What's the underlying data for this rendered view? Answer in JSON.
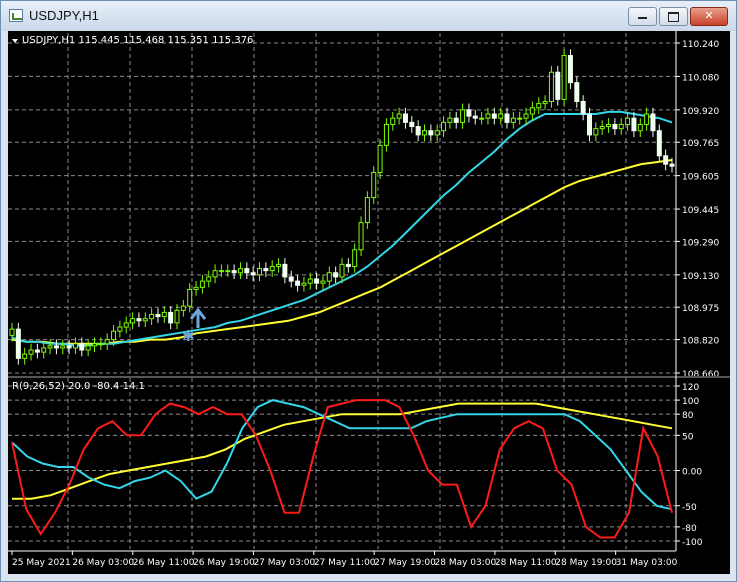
{
  "window": {
    "title": "USDJPY,H1",
    "min_label": "–",
    "max_label": "▢",
    "close_label": "✕"
  },
  "main_panel": {
    "info_label": "USDJPY,H1  115.445 115.468 115.351 115.376"
  },
  "indicator_panel": {
    "info_label": "R(9,26,52) 20.0 -80.4 14.1"
  },
  "colors": {
    "background": "#000000",
    "grid": "#8a8a8a",
    "bull_candle": "#7cfc00",
    "bear_candle": "#f0fff0",
    "ma_fast": "#33d6e8",
    "ma_slow": "#ffff33",
    "osc_red": "#ff1a1a",
    "osc_cyan": "#33d6e8",
    "osc_yellow": "#ffff33",
    "arrow": "#6fa8dc"
  },
  "chart_data": [
    {
      "type": "candlestick",
      "title": "USDJPY,H1",
      "y_axis_ticks": [
        "110.240",
        "110.080",
        "109.920",
        "109.765",
        "109.605",
        "109.445",
        "109.290",
        "109.130",
        "108.975",
        "108.820",
        "108.660"
      ],
      "ylim": [
        108.66,
        110.24
      ],
      "x_axis_ticks": [
        "25 May 2021",
        "26 May 03:00",
        "26 May 11:00",
        "26 May 19:00",
        "27 May 03:00",
        "27 May 11:00",
        "27 May 19:00",
        "28 May 03:00",
        "28 May 11:00",
        "28 May 19:00",
        "31 May 03:00"
      ],
      "grid": true,
      "close": [
        108.87,
        108.73,
        108.75,
        108.77,
        108.76,
        108.78,
        108.79,
        108.78,
        108.79,
        108.78,
        108.8,
        108.77,
        108.79,
        108.8,
        108.8,
        108.82,
        108.86,
        108.88,
        108.9,
        108.92,
        108.91,
        108.92,
        108.94,
        108.93,
        108.95,
        108.9,
        108.96,
        108.98,
        109.06,
        109.07,
        109.1,
        109.12,
        109.15,
        109.15,
        109.15,
        109.14,
        109.16,
        109.14,
        109.13,
        109.16,
        109.15,
        109.17,
        109.18,
        109.12,
        109.1,
        109.08,
        109.09,
        109.11,
        109.09,
        109.1,
        109.14,
        109.12,
        109.18,
        109.17,
        109.25,
        109.38,
        109.5,
        109.62,
        109.75,
        109.85,
        109.88,
        109.9,
        109.86,
        109.84,
        109.8,
        109.82,
        109.8,
        109.82,
        109.86,
        109.88,
        109.86,
        109.92,
        109.89,
        109.88,
        109.88,
        109.9,
        109.88,
        109.9,
        109.86,
        109.88,
        109.88,
        109.9,
        109.93,
        109.95,
        109.96,
        110.1,
        109.97,
        110.18,
        110.05,
        109.96,
        109.9,
        109.8,
        109.83,
        109.84,
        109.85,
        109.83,
        109.85,
        109.88,
        109.82,
        109.85,
        109.9,
        109.82,
        109.7,
        109.66,
        109.65
      ],
      "series": [
        {
          "name": "MA fast",
          "values": [
            108.83,
            108.81,
            108.81,
            108.8,
            108.8,
            108.79,
            108.79,
            108.8,
            108.8,
            108.81,
            108.82,
            108.83,
            108.84,
            108.85,
            108.86,
            108.87,
            108.88,
            108.9,
            108.91,
            108.93,
            108.95,
            108.97,
            108.99,
            109.01,
            109.04,
            109.07,
            109.1,
            109.13,
            109.17,
            109.22,
            109.27,
            109.33,
            109.39,
            109.45,
            109.51,
            109.56,
            109.62,
            109.67,
            109.72,
            109.78,
            109.83,
            109.87,
            109.9,
            109.9,
            109.9,
            109.9,
            109.9,
            109.91,
            109.91,
            109.9,
            109.89,
            109.88,
            109.86
          ]
        },
        {
          "name": "MA slow",
          "values": [
            108.82,
            108.81,
            108.81,
            108.8,
            108.8,
            108.8,
            108.8,
            108.81,
            108.81,
            108.82,
            108.82,
            108.83,
            108.85,
            108.86,
            108.87,
            108.88,
            108.89,
            108.9,
            108.91,
            108.93,
            108.95,
            108.98,
            109.01,
            109.04,
            109.07,
            109.11,
            109.15,
            109.19,
            109.23,
            109.27,
            109.31,
            109.35,
            109.39,
            109.43,
            109.47,
            109.51,
            109.55,
            109.58,
            109.6,
            109.62,
            109.64,
            109.66,
            109.67,
            109.68
          ]
        }
      ]
    },
    {
      "type": "line",
      "title": "R(9,26,52) 20.0 -80.4 14.1",
      "y_axis_ticks": [
        "120",
        "100",
        "80",
        "50",
        "0.00",
        "-50",
        "-80",
        "-100"
      ],
      "ylim": [
        -100,
        120
      ],
      "grid": true,
      "series": [
        {
          "name": "R(9)",
          "values": [
            40,
            -55,
            -90,
            -60,
            -20,
            30,
            60,
            70,
            50,
            50,
            80,
            95,
            90,
            80,
            90,
            80,
            80,
            50,
            0,
            -60,
            -60,
            20,
            90,
            95,
            100,
            100,
            100,
            90,
            50,
            0,
            -20,
            -20,
            -80,
            -50,
            30,
            60,
            70,
            60,
            0,
            -20,
            -80,
            -95,
            -95,
            -60,
            60,
            20,
            -60
          ]
        },
        {
          "name": "R(26)",
          "values": [
            40,
            20,
            10,
            5,
            5,
            -10,
            -20,
            -25,
            -15,
            -10,
            0,
            -15,
            -40,
            -30,
            10,
            60,
            90,
            100,
            95,
            90,
            80,
            70,
            60,
            60,
            60,
            60,
            60,
            70,
            75,
            80,
            80,
            80,
            80,
            80,
            80,
            80,
            80,
            70,
            50,
            30,
            0,
            -30,
            -50,
            -55
          ]
        },
        {
          "name": "R(52)",
          "values": [
            -40,
            -40,
            -35,
            -25,
            -15,
            -5,
            0,
            5,
            10,
            15,
            20,
            30,
            45,
            55,
            65,
            70,
            75,
            80,
            80,
            80,
            80,
            85,
            90,
            95,
            95,
            95,
            95,
            95,
            90,
            85,
            80,
            75,
            70,
            65,
            60
          ]
        }
      ]
    }
  ]
}
